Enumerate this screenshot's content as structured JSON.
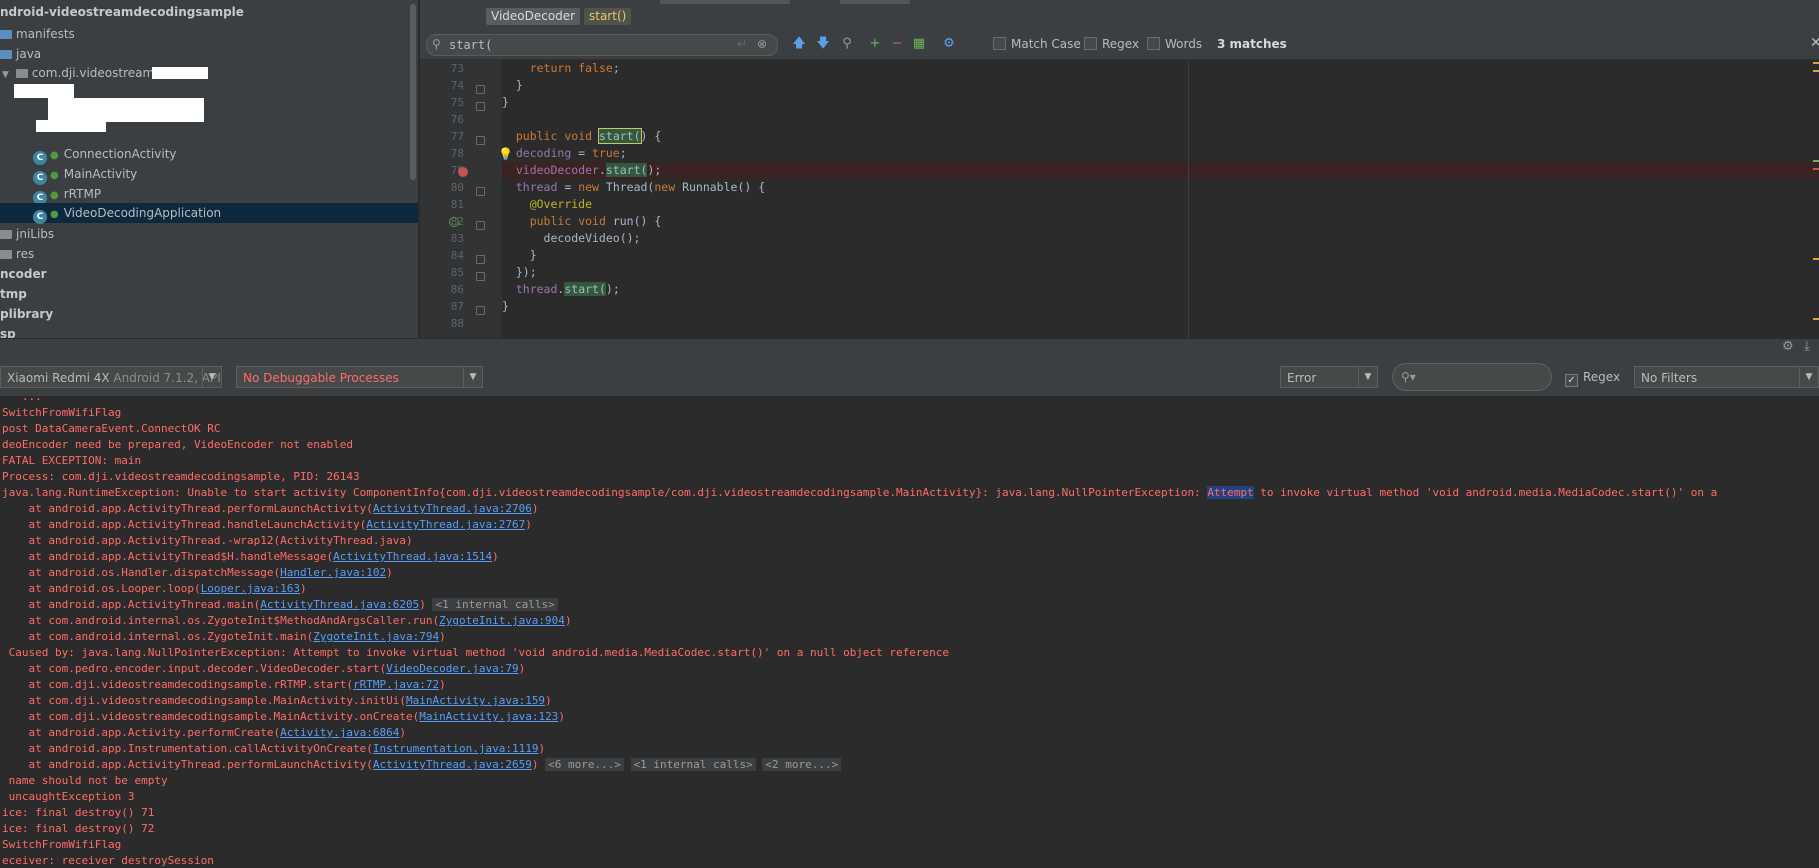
{
  "project": {
    "root": "ndroid-videostreamdecodingsample",
    "items": [
      {
        "label": "manifests",
        "icon": "folder-icon"
      },
      {
        "label": "java",
        "icon": "folder-icon"
      },
      {
        "label": "com.dji.videostreamdecod",
        "icon": "package-icon"
      },
      {
        "label": "ConnectionActivity",
        "icon": "class-icon"
      },
      {
        "label": "MainActivity",
        "icon": "class-icon"
      },
      {
        "label": "rRTMP",
        "icon": "class-icon"
      },
      {
        "label": "VideoDecodingApplication",
        "icon": "class-icon"
      },
      {
        "label": "jniLibs",
        "icon": "folder-icon"
      },
      {
        "label": "res",
        "icon": "folder-icon"
      },
      {
        "label": "ncoder"
      },
      {
        "label": "tmp"
      },
      {
        "label": "plibrary"
      },
      {
        "label": "sp"
      }
    ]
  },
  "editor": {
    "breadcrumb": {
      "class": "VideoDecoder",
      "method": "start()"
    },
    "find": {
      "query": "start(",
      "match_case": "Match Case",
      "regex": "Regex",
      "words": "Words",
      "matches": "3 matches"
    },
    "lines": [
      {
        "n": "73",
        "text": "    return false;"
      },
      {
        "n": "74",
        "text": "  }"
      },
      {
        "n": "75",
        "text": "}"
      },
      {
        "n": "76",
        "text": ""
      },
      {
        "n": "77",
        "text": "  public void start() {"
      },
      {
        "n": "78",
        "text": "  decoding = true;"
      },
      {
        "n": "79",
        "text": "  videoDecoder.start();"
      },
      {
        "n": "80",
        "text": "  thread = new Thread(new Runnable() {"
      },
      {
        "n": "81",
        "text": "    @Override"
      },
      {
        "n": "82",
        "text": "    public void run() {"
      },
      {
        "n": "83",
        "text": "      decodeVideo();"
      },
      {
        "n": "84",
        "text": "    }"
      },
      {
        "n": "85",
        "text": "  });"
      },
      {
        "n": "86",
        "text": "  thread.start();"
      },
      {
        "n": "87",
        "text": "}"
      },
      {
        "n": "88",
        "text": ""
      }
    ]
  },
  "logcat": {
    "device": "Xiaomi Redmi 4X",
    "device_sub": "Android 7.1.2, API 25",
    "process": "No Debuggable Processes",
    "level": "Error",
    "search_placeholder": "",
    "regex_label": "Regex",
    "filters": "No Filters",
    "lines": [
      "   ...",
      "SwitchFromWifiFlag",
      "post DataCameraEvent.ConnectOK RC",
      "deoEncoder need be prepared, VideoEncoder not enabled",
      "FATAL EXCEPTION: main",
      "Process: com.dji.videostreamdecodingsample, PID: 26143",
      "java.lang.RuntimeException: Unable to start activity ComponentInfo{com.dji.videostreamdecodingsample/com.dji.videostreamdecodingsample.MainActivity}: java.lang.NullPointerException: Attempt to invoke virtual method 'void android.media.MediaCodec.start()' on a",
      "    at android.app.ActivityThread.performLaunchActivity(ActivityThread.java:2706)",
      "    at android.app.ActivityThread.handleLaunchActivity(ActivityThread.java:2767)",
      "    at android.app.ActivityThread.-wrap12(ActivityThread.java)",
      "    at android.app.ActivityThread$H.handleMessage(ActivityThread.java:1514)",
      "    at android.os.Handler.dispatchMessage(Handler.java:102)",
      "    at android.os.Looper.loop(Looper.java:163)",
      "    at android.app.ActivityThread.main(ActivityThread.java:6205) <1 internal calls>",
      "    at com.android.internal.os.ZygoteInit$MethodAndArgsCaller.run(ZygoteInit.java:904)",
      "    at com.android.internal.os.ZygoteInit.main(ZygoteInit.java:794)",
      " Caused by: java.lang.NullPointerException: Attempt to invoke virtual method 'void android.media.MediaCodec.start()' on a null object reference",
      "    at com.pedro.encoder.input.decoder.VideoDecoder.start(VideoDecoder.java:79)",
      "    at com.dji.videostreamdecodingsample.rRTMP.start(rRTMP.java:72)",
      "    at com.dji.videostreamdecodingsample.MainActivity.initUi(MainActivity.java:159)",
      "    at com.dji.videostreamdecodingsample.MainActivity.onCreate(MainActivity.java:123)",
      "    at android.app.Activity.performCreate(Activity.java:6864)",
      "    at android.app.Instrumentation.callActivityOnCreate(Instrumentation.java:1119)",
      "    at android.app.ActivityThread.performLaunchActivity(ActivityThread.java:2659) <6 more...> <1 internal calls> <2 more...>",
      " name should not be empty",
      " uncaughtException 3",
      "ice: final destroy() 71",
      "ice: final destroy() 72",
      "SwitchFromWifiFlag",
      "eceiver: receiver destroySession"
    ]
  }
}
